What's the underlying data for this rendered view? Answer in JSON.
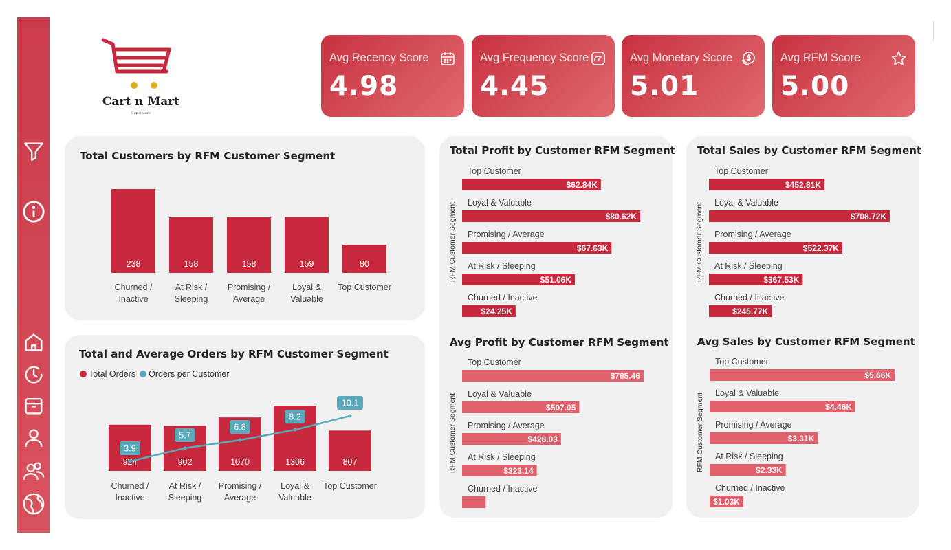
{
  "brand": {
    "name": "Cart n Mart",
    "tagline": "Superstore"
  },
  "colors": {
    "primary": "#c8283c",
    "light": "#e0606b",
    "line": "#5aaabb",
    "panel": "#f1f1f1"
  },
  "sidebar": {
    "icons": [
      "filter-icon",
      "info-icon",
      "home-icon",
      "history-icon",
      "package-icon",
      "user-icon",
      "users-icon",
      "globe-icon"
    ]
  },
  "kpis": [
    {
      "label": "Avg Recency Score",
      "value": "4.98",
      "icon": "calendar-icon"
    },
    {
      "label": "Avg Frequency Score",
      "value": "4.45",
      "icon": "gauge-icon"
    },
    {
      "label": "Avg Monetary Score",
      "value": "5.01",
      "icon": "dollar-icon"
    },
    {
      "label": "Avg RFM Score",
      "value": "5.00",
      "icon": "star-icon"
    }
  ],
  "chart_data": [
    {
      "type": "bar",
      "title": "Total Customers by RFM Customer Segment",
      "categories": [
        "Churned / Inactive",
        "At Risk / Sleeping",
        "Promising / Average",
        "Loyal & Valuable",
        "Top Customer"
      ],
      "values": [
        238,
        158,
        158,
        159,
        80
      ],
      "labels": [
        "238",
        "158",
        "158",
        "159",
        "80"
      ]
    },
    {
      "type": "bar",
      "title": "Total and Average Orders by RFM Customer Segment",
      "legend": [
        "Total Orders",
        "Orders per Customer"
      ],
      "categories": [
        "Churned / Inactive",
        "At Risk / Sleeping",
        "Promising / Average",
        "Loyal & Valuable",
        "Top Customer"
      ],
      "series": [
        {
          "name": "Total Orders",
          "type": "bar",
          "values": [
            924,
            902,
            1070,
            1306,
            807
          ],
          "labels": [
            "924",
            "902",
            "1070",
            "1306",
            "807"
          ]
        },
        {
          "name": "Orders per Customer",
          "type": "line",
          "values": [
            3.9,
            5.7,
            6.8,
            8.2,
            10.1
          ],
          "labels": [
            "3.9",
            "5.7",
            "6.8",
            "8.2",
            "10.1"
          ]
        }
      ]
    },
    {
      "type": "bar",
      "title": "Total Profit by Customer RFM Segment",
      "ylabel": "RFM Customer Segment",
      "categories": [
        "Top Customer",
        "Loyal & Valuable",
        "Promising / Average",
        "At Risk / Sleeping",
        "Churned / Inactive"
      ],
      "values": [
        62840,
        80620,
        67630,
        51060,
        24250
      ],
      "labels": [
        "$62.84K",
        "$80.62K",
        "$67.63K",
        "$51.06K",
        "$24.25K"
      ]
    },
    {
      "type": "bar",
      "title": "Total Sales by Customer RFM Segment",
      "ylabel": "RFM Customer Segment",
      "categories": [
        "Top Customer",
        "Loyal & Valuable",
        "Promising / Average",
        "At Risk / Sleeping",
        "Churned / Inactive"
      ],
      "values": [
        452810,
        708720,
        522370,
        367530,
        245770
      ],
      "labels": [
        "$452.81K",
        "$708.72K",
        "$522.37K",
        "$367.53K",
        "$245.77K"
      ]
    },
    {
      "type": "bar",
      "title": "Avg Profit by Customer RFM Segment",
      "ylabel": "RFM Customer Segment",
      "categories": [
        "Top Customer",
        "Loyal & Valuable",
        "Promising / Average",
        "At Risk / Sleeping",
        "Churned / Inactive"
      ],
      "values": [
        785.46,
        507.05,
        428.03,
        323.14,
        101.9
      ],
      "labels": [
        "$785.46",
        "$507.05",
        "$428.03",
        "$323.14",
        ""
      ]
    },
    {
      "type": "bar",
      "title": "Avg Sales by Customer RFM Segment",
      "ylabel": "RFM Customer Segment",
      "categories": [
        "Top Customer",
        "Loyal & Valuable",
        "Promising / Average",
        "At Risk / Sleeping",
        "Churned / Inactive"
      ],
      "values": [
        5660,
        4460,
        3310,
        2330,
        1030
      ],
      "labels": [
        "$5.66K",
        "$4.46K",
        "$3.31K",
        "$2.33K",
        "$1.03K"
      ]
    }
  ]
}
